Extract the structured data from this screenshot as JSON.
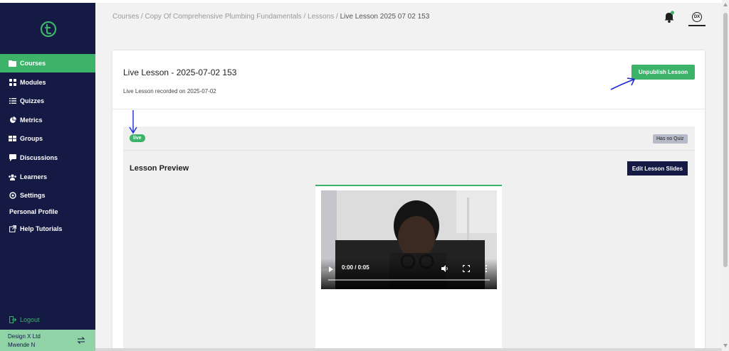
{
  "colors": {
    "sidebar_bg": "#141a44",
    "accent_green": "#3db36a",
    "annotation_blue": "#1a2ad8"
  },
  "sidebar": {
    "logo_icon": "brand-logo-icon",
    "items": [
      {
        "label": "Courses",
        "icon": "folder-icon",
        "active": true
      },
      {
        "label": "Modules",
        "icon": "grid-icon",
        "active": false
      },
      {
        "label": "Quizzes",
        "icon": "list-icon",
        "active": false
      },
      {
        "label": "Metrics",
        "icon": "pie-chart-icon",
        "active": false
      },
      {
        "label": "Groups",
        "icon": "groups-icon",
        "active": false
      },
      {
        "label": "Discussions",
        "icon": "chat-bubble-icon",
        "active": false
      },
      {
        "label": "Learners",
        "icon": "users-icon",
        "active": false
      },
      {
        "label": "Settings",
        "icon": "gear-icon",
        "active": false
      }
    ],
    "personal_profile": "Personal Profile",
    "help_tutorials": "Help Tutorials",
    "logout": "Logout",
    "org_name": "Design X Ltd",
    "user_name": "Mwende N"
  },
  "header": {
    "breadcrumb": {
      "path": "Courses / Copy Of Comprehensive Plumbing Fundamentals  / Lessons / ",
      "current": "Live Lesson 2025 07 02 153"
    },
    "avatar_text": "DX"
  },
  "lesson": {
    "title": "Live Lesson - 2025-07-02 153",
    "subtitle": "Live Lesson recorded on 2025-07-02",
    "unpublish_label": "Unpublish Lesson",
    "status_badge": "live",
    "quiz_badge": "Has no Quiz",
    "preview_title": "Lesson Preview",
    "edit_slides_label": "Edit Lesson Slides"
  },
  "video": {
    "time": "0:00 / 0:05",
    "progress": 0
  }
}
